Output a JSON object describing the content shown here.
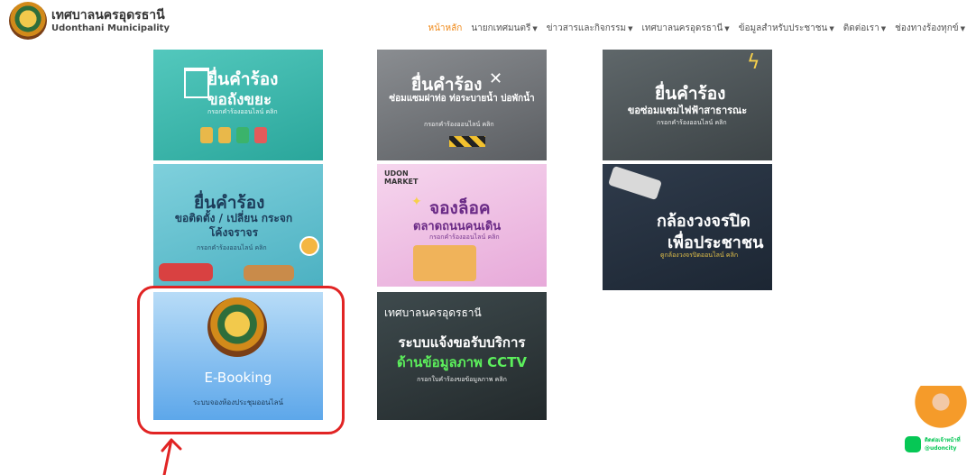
{
  "header": {
    "brand_th": "เทศบาลนครอุดรธานี",
    "brand_en": "Udonthani Municipality",
    "nav": [
      {
        "label": "หน้าหลัก",
        "active": true
      },
      {
        "label": "นายกเทศมนตรี",
        "dropdown": true
      },
      {
        "label": "ข่าวสารและกิจกรรม",
        "dropdown": true
      },
      {
        "label": "เทศบาลนครอุดรธานี",
        "dropdown": true
      },
      {
        "label": "ข้อมูลสำหรับประชาชน",
        "dropdown": true
      },
      {
        "label": "ติดต่อเรา",
        "dropdown": true
      },
      {
        "label": "ช่องทางร้องทุกข์",
        "dropdown": true
      }
    ]
  },
  "tiles": {
    "garbage": {
      "line1": "ยื่นคำร้อง",
      "line2": "ขอถังขยะ",
      "small": "กรอกคำร้องออนไลน์ คลิก"
    },
    "drain": {
      "line1": "ยื่นคำร้อง",
      "line2": "ซ่อมแซมฝาท่อ ท่อระบายน้ำ บ่อพักน้ำ",
      "small": "กรอกคำร้องออนไลน์ คลิก"
    },
    "lights": {
      "line1": "ยื่นคำร้อง",
      "line2": "ขอซ่อมแซมไฟฟ้าสาธารณะ",
      "small": "กรอกคำร้องออนไลน์ คลิก"
    },
    "mirror": {
      "line1": "ยื่นคำร้อง",
      "line2": "ขอติดตั้ง / เปลี่ยน กระจกโค้งจราจร",
      "small": "กรอกคำร้องออนไลน์ คลิก"
    },
    "market": {
      "brand": "UDON MARKET",
      "line1": "จองล็อค",
      "line2": "ตลาดถนนคนเดิน",
      "small": "กรอกคำร้องออนไลน์ คลิก"
    },
    "cctv_public": {
      "line1": "กล้องวงจรปิด",
      "line2": "เพื่อประชาชน",
      "small": "ดูกล้องวงจรปิดออนไลน์ คลิก"
    },
    "ebooking": {
      "title": "E-Booking",
      "subtitle": "ระบบจองห้องประชุมออนไลน์"
    },
    "cctv_request": {
      "org": "เทศบาลนครอุดรธานี",
      "line1": "ระบบแจ้งขอรับบริการ",
      "line2": "ด้านข้อมูลภาพ CCTV",
      "small": "กรอกใบคำร้องขอข้อมูลภาพ คลิก"
    }
  },
  "chat": {
    "line1": "ติดต่อเจ้าหน้าที่",
    "line2": "@udoncity"
  }
}
